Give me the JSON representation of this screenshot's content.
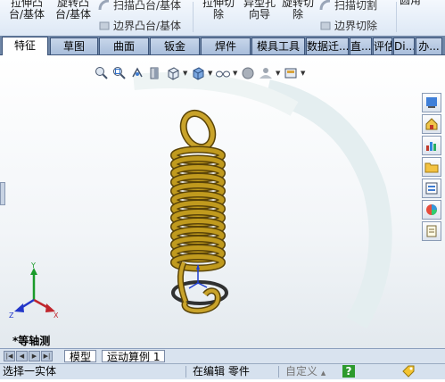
{
  "ribbon": {
    "extrude_boss": "拉伸凸\n台/基体",
    "revolve_boss": "旋转凸\n台/基体",
    "sweep_boss": "扫描凸台/基体",
    "boundary_boss": "边界凸台/基体",
    "extrude_cut": "拉伸切\n除",
    "hole_wizard": "异型孔\n向导",
    "revolve_cut": "旋转切\n除",
    "sweep_cut": "扫描切割",
    "boundary_cut": "边界切除",
    "overflow": "圆角"
  },
  "tabs": [
    {
      "label": "特征",
      "active": true
    },
    {
      "label": "草图"
    },
    {
      "label": "曲面"
    },
    {
      "label": "钣金"
    },
    {
      "label": "焊件"
    },
    {
      "label": "模具工具"
    },
    {
      "label": "数据迁..."
    },
    {
      "label": "直..."
    },
    {
      "label": "评估"
    },
    {
      "label": "Di..."
    },
    {
      "label": "办..."
    }
  ],
  "viewport": {
    "view_label": "*等轴测",
    "triad": {
      "x": "X",
      "y": "Y",
      "z": "Z"
    },
    "spring_color": "#c09a1e",
    "background_top": "#ffffff",
    "background_bottom": "#e3e9ee"
  },
  "hud_icons": [
    "zoom-to-fit-icon",
    "zoom-area-icon",
    "previous-view-icon",
    "section-view-icon",
    "view-orientation-icon",
    "display-style-icon",
    "hide-show-icon",
    "edit-appearance-icon",
    "scene-icon",
    "view-settings-icon"
  ],
  "taskpane_icons": [
    "resources-icon",
    "design-library-icon",
    "file-explorer-icon",
    "view-palette-icon",
    "appearances-icon",
    "custom-properties-icon",
    "folder-icon"
  ],
  "bottom_tabs": [
    "模型",
    "运动算例 1"
  ],
  "status": {
    "message": "选择一实体",
    "mode": "在编辑 零件",
    "units": "自定义",
    "units_arrow": "▲",
    "help": "?"
  }
}
